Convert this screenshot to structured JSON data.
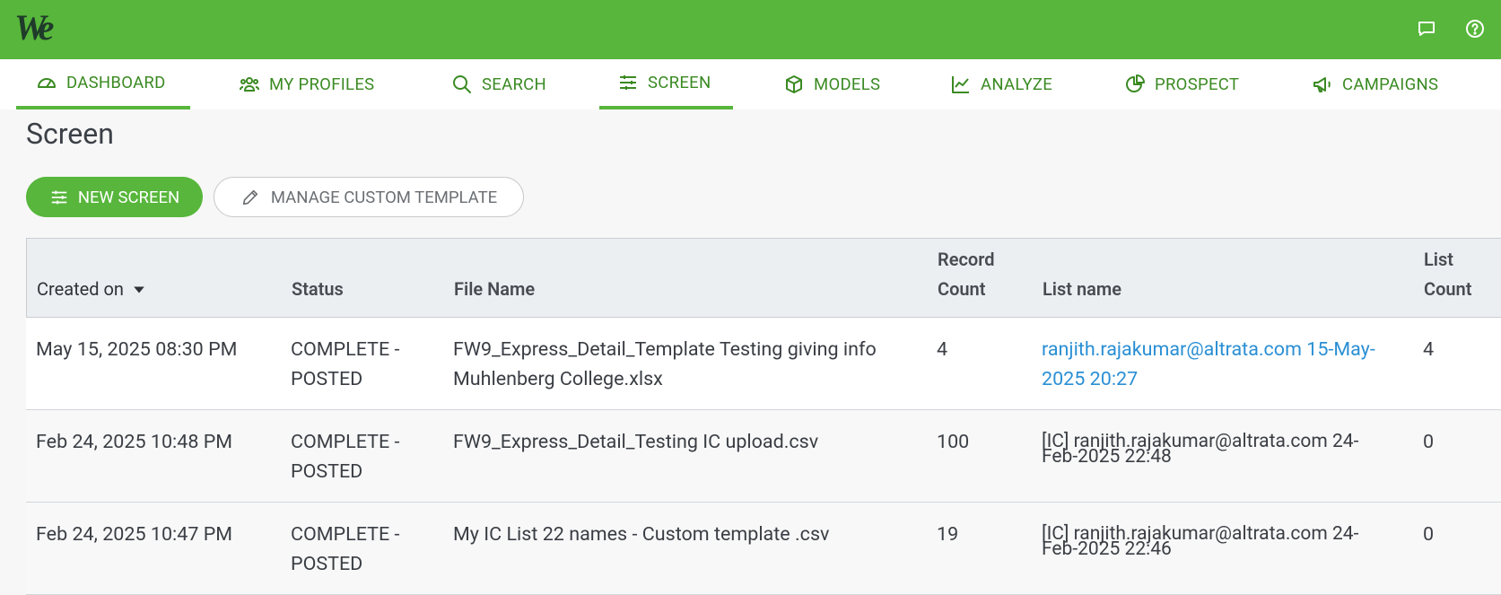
{
  "app": {
    "logo_text": "We"
  },
  "topbar": {
    "icons": [
      "chat-icon",
      "help-icon"
    ]
  },
  "nav": {
    "items": [
      {
        "label": "DASHBOARD",
        "icon": "gauge-icon"
      },
      {
        "label": "MY PROFILES",
        "icon": "people-icon"
      },
      {
        "label": "SEARCH",
        "icon": "search-icon"
      },
      {
        "label": "SCREEN",
        "icon": "sliders-icon",
        "active": true
      },
      {
        "label": "MODELS",
        "icon": "cube-icon"
      },
      {
        "label": "ANALYZE",
        "icon": "line-chart-icon"
      },
      {
        "label": "PROSPECT",
        "icon": "pie-chart-icon"
      },
      {
        "label": "CAMPAIGNS",
        "icon": "megaphone-icon"
      }
    ]
  },
  "page": {
    "title": "Screen",
    "new_screen_label": "NEW SCREEN",
    "manage_template_label": "MANAGE CUSTOM TEMPLATE"
  },
  "table": {
    "headers": {
      "created_on": "Created on",
      "status": "Status",
      "file_name": "File Name",
      "record_count_1": "Record",
      "record_count_2": "Count",
      "list_name": "List name",
      "list_count_1": "List",
      "list_count_2": "Count"
    },
    "rows": [
      {
        "created_on": "May 15, 2025 08:30 PM",
        "status_1": "COMPLETE -",
        "status_2": "POSTED",
        "file_name_1": "FW9_Express_Detail_Template Testing giving info",
        "file_name_2": "Muhlenberg College.xlsx",
        "record_count": "4",
        "list_name_1": "ranjith.rajakumar@altrata.com 15-May-",
        "list_name_2": "2025 20:27",
        "list_count": "4"
      },
      {
        "created_on": "Feb 24, 2025 10:48 PM",
        "status_1": "COMPLETE -",
        "status_2": "POSTED",
        "file_name_1": "FW9_Express_Detail_Testing IC upload.csv",
        "record_count": "100",
        "list_name_1": "[IC] ranjith.rajakumar@altrata.com 24-",
        "list_name_2": "Feb-2025 22:48",
        "list_count": "0"
      },
      {
        "created_on": "Feb 24, 2025 10:47 PM",
        "status_1": "COMPLETE -",
        "status_2": "POSTED",
        "file_name_1": "My IC List 22 names - Custom template .csv",
        "record_count": "19",
        "list_name_1": "[IC] ranjith.rajakumar@altrata.com 24-",
        "list_name_2": "Feb-2025 22:46",
        "list_count": "0"
      }
    ]
  },
  "colors": {
    "brand_green": "#57b63b",
    "nav_text": "#3a8a22",
    "link_blue": "#2a8fd4"
  }
}
